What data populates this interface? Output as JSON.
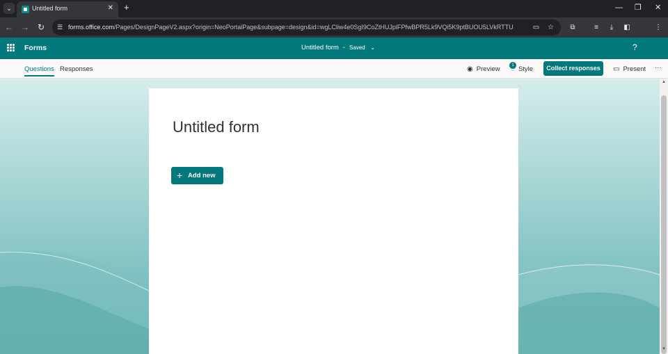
{
  "browser": {
    "tab_title": "Untitled form",
    "tab_close": "✕",
    "new_tab": "+",
    "url_host": "forms.office.com",
    "url_path": "/Pages/DesignPageV2.aspx?origin=NeoPortalPage&subpage=design&id=wgLCliw4e0SgI9CoZtHUJplFPfwBPR5Lk9VQi5K9ptBUOU5LVkRTTUJZNzRaM1pR..."
  },
  "app": {
    "name": "Forms",
    "doc_title": "Untitled form",
    "separator": "-",
    "save_status": "Saved",
    "help": "?"
  },
  "commands": {
    "tabs": [
      "Questions",
      "Responses"
    ],
    "preview": "Preview",
    "style": "Style",
    "style_badge": "1",
    "collect": "Collect responses",
    "present": "Present",
    "more": "···"
  },
  "form": {
    "title": "Untitled form",
    "add_new": "Add new"
  },
  "colors": {
    "brand": "#03787c",
    "browser_bg": "#202124",
    "toolbar_bg": "#35363a"
  }
}
